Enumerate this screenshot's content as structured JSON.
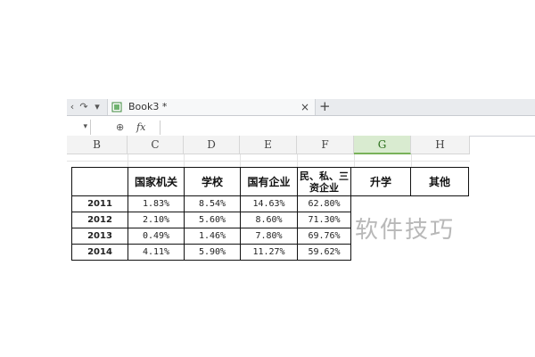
{
  "tabbar": {
    "nav_back": "‹",
    "nav_forward": "↷",
    "nav_menu": "▾",
    "tab_title": "Book3 *",
    "close_glyph": "×",
    "add_glyph": "+"
  },
  "formula_bar": {
    "name_box_arrow": "▾",
    "zoom_glyph": "⊕",
    "fx_label": "fx",
    "value": ""
  },
  "columns": [
    "B",
    "C",
    "D",
    "E",
    "F",
    "G",
    "H"
  ],
  "selected_column": "G",
  "table": {
    "headers": [
      "",
      "国家机关",
      "学校",
      "国有企业",
      "民、私、三资企业",
      "升学",
      "其他"
    ],
    "rows": [
      {
        "year": "2011",
        "values": [
          "1.83%",
          "8.54%",
          "14.63%",
          "62.80%"
        ]
      },
      {
        "year": "2012",
        "values": [
          "2.10%",
          "5.60%",
          "8.60%",
          "71.30%"
        ]
      },
      {
        "year": "2013",
        "values": [
          "0.49%",
          "1.46%",
          "7.80%",
          "69.76%"
        ]
      },
      {
        "year": "2014",
        "values": [
          "4.11%",
          "5.90%",
          "11.27%",
          "59.62%"
        ]
      }
    ]
  },
  "watermark": "软件技巧",
  "colors": {
    "selected_column_fill": "#d9ebd0",
    "selected_column_accent": "#79b25a"
  }
}
